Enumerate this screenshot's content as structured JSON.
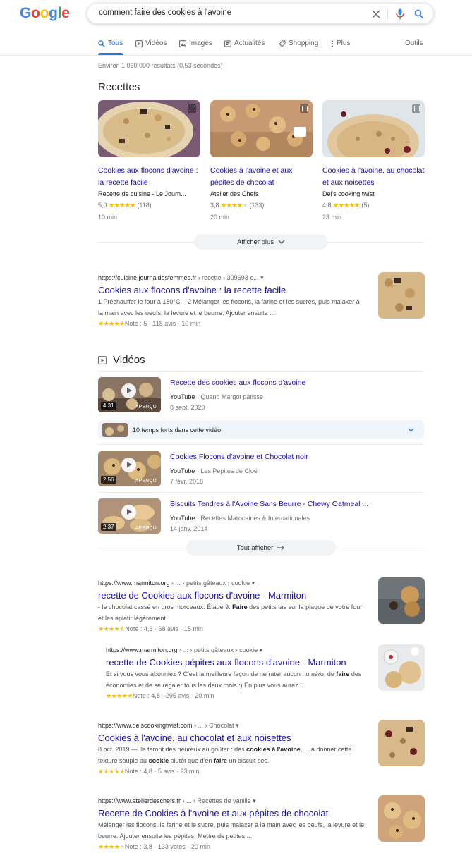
{
  "header": {
    "logo_letters": [
      {
        "ch": "G",
        "color": "#4285f4"
      },
      {
        "ch": "o",
        "color": "#ea4335"
      },
      {
        "ch": "o",
        "color": "#fbbc05"
      },
      {
        "ch": "g",
        "color": "#4285f4"
      },
      {
        "ch": "l",
        "color": "#34a853"
      },
      {
        "ch": "e",
        "color": "#ea4335"
      }
    ],
    "search_query": "comment faire des cookies à l'avoine",
    "icons": [
      "close-icon",
      "mic-icon",
      "search-icon"
    ]
  },
  "tabs": [
    {
      "label": "Tous",
      "icon": "search-icon",
      "active": true
    },
    {
      "label": "Vidéos",
      "icon": "video-icon"
    },
    {
      "label": "Images",
      "icon": "image-icon"
    },
    {
      "label": "Actualités",
      "icon": "news-icon"
    },
    {
      "label": "Shopping",
      "icon": "tag-icon"
    },
    {
      "label": "Plus",
      "icon": "more-icon"
    }
  ],
  "tools_label": "Outils",
  "stats": "Environ 1 030 000 résultats (0,53 secondes)",
  "recipes": {
    "heading": "Recettes",
    "items": [
      {
        "title": "Cookies aux flocons d'avoine : la recette facile",
        "source": "Recette de cuisine - Le Journ...",
        "rating": "5,0",
        "stars": 5,
        "count": "(118)",
        "time": "10 min"
      },
      {
        "title": "Cookies à l'avoine et aux pépites de chocolat",
        "source": "Atelier des Chefs",
        "rating": "3,8",
        "stars": 4,
        "count": "(133)",
        "time": "20 min"
      },
      {
        "title": "Cookies à l'avoine, au chocolat et aux noisettes",
        "source": "Del's cooking twist",
        "rating": "4,8",
        "stars": 5,
        "count": "(5)",
        "time": "23 min"
      }
    ],
    "more_label": "Afficher plus"
  },
  "result1": {
    "url": "https://cuisine.journaldesfemmes.fr",
    "crumb": " › recette › 309693-c...",
    "title": "Cookies aux flocons d'avoine : la recette facile",
    "snippet": "1 Préchauffer le four à 180°C. · 2 Mélanger les flocons, la farine et les sucres, puis malaxer à la main avec les oeufs, la levure et le beurre. Ajouter ensuite ...",
    "meta": "Note : 5 · 118 avis · 10 min",
    "stars": 5
  },
  "videos": {
    "heading": "Vidéos",
    "items": [
      {
        "title": "Recette des cookies aux flocons d'avoine",
        "platform": "YouTube",
        "channel": "Quand Margot pâtisse",
        "date": "8 sept. 2020",
        "duration": "4:31",
        "preview": "APERÇU"
      },
      {
        "title": "Cookies Flocons d'avoine et Chocolat noir",
        "platform": "YouTube",
        "channel": "Les Pépites de Cloé",
        "date": "7 févr. 2018",
        "duration": "2:56",
        "preview": "APERÇU"
      },
      {
        "title": "Biscuits Tendres à l'Avoine Sans Beurre - Chewy Oatmeal ...",
        "platform": "YouTube",
        "channel": "Recettes Marocaines & Internationales",
        "date": "14 janv. 2014",
        "duration": "2:37",
        "preview": "APERÇU"
      }
    ],
    "key_moments": "10 temps forts dans cette vidéo",
    "show_all": "Tout afficher"
  },
  "result2": {
    "url": "https://www.marmiton.org",
    "crumb": " › ... › petits gâteaux › cookie",
    "title": "recette de Cookies aux flocons d'avoine - Marmiton",
    "snippet_a": "- le chocolat cassé en gros morceaux. Étape 9. ",
    "snippet_b": "Faire",
    "snippet_c": " des petits tas sur la plaque de votre four et les aplatir légèrement.",
    "meta": "Note : 4,6 · 68 avis · 15 min",
    "stars": 4.5
  },
  "result3": {
    "url": "https://www.marmiton.org",
    "crumb": " › ... › petits gâteaux › cookie",
    "title": "recette de Cookies pépites aux flocons d'avoine - Marmiton",
    "snippet_a": "Et si vous vous abonniez ? C'est la meilleure façon de ne rater aucun numéro, de ",
    "snippet_b": "faire",
    "snippet_c": " des économies et de se régaler tous les deux mois :) En plus vous aurez ...",
    "meta": "Note : 4,8 · 295 avis · 20 min",
    "stars": 5
  },
  "result4": {
    "url": "https://www.delscookingtwist.com",
    "crumb": " › ... › Chocolat",
    "title": "Cookies à l'avoine, au chocolat et aux noisettes",
    "snippet_a": "8 oct. 2019 — Ils feront des heureux au goûter : des ",
    "snippet_b": "cookies à l'avoine",
    "snippet_c": ", ... à donner cette texture souple au ",
    "snippet_d": "cookie",
    "snippet_e": " plutôt que d'en ",
    "snippet_f": "faire",
    "snippet_g": " un biscuit sec.",
    "meta": "Note : 4,8 · 5 avis · 23 min",
    "stars": 5
  },
  "result5": {
    "url": "https://www.atelierdeschefs.fr",
    "crumb": " › ... › Recettes de vanille",
    "title": "Recette de Cookies à l'avoine et aux pépites de chocolat",
    "snippet": "Mélanger les flocons, la farine et le sucre, puis malaxer à la main avec les oeufs, la levure et le beurre. Ajouter ensuite les pépites. Mettre de petites ...",
    "meta": "Note : 3,8 · 133 votes · 20 min",
    "stars": 4
  },
  "colors": {
    "link": "#1a0dab",
    "accent": "#1a73e8",
    "star": "#fbbc04"
  }
}
